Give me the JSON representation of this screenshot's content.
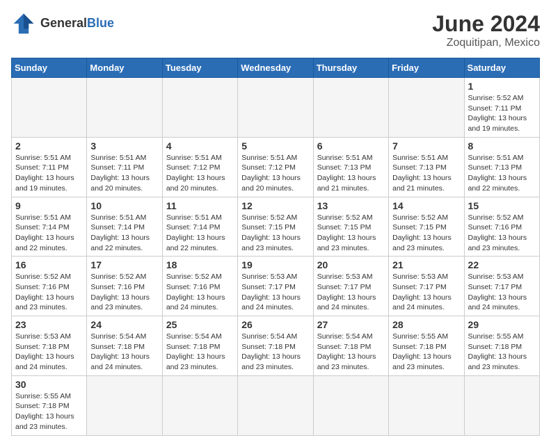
{
  "header": {
    "logo_general": "General",
    "logo_blue": "Blue",
    "month_title": "June 2024",
    "location": "Zoquitipan, Mexico"
  },
  "days_of_week": [
    "Sunday",
    "Monday",
    "Tuesday",
    "Wednesday",
    "Thursday",
    "Friday",
    "Saturday"
  ],
  "weeks": [
    [
      {
        "day": "",
        "empty": true
      },
      {
        "day": "",
        "empty": true
      },
      {
        "day": "",
        "empty": true
      },
      {
        "day": "",
        "empty": true
      },
      {
        "day": "",
        "empty": true
      },
      {
        "day": "",
        "empty": true
      },
      {
        "day": "1",
        "sunrise": "5:52 AM",
        "sunset": "7:11 PM",
        "daylight": "13 hours and 19 minutes."
      }
    ],
    [
      {
        "day": "2",
        "sunrise": "5:51 AM",
        "sunset": "7:11 PM",
        "daylight": "13 hours and 19 minutes."
      },
      {
        "day": "3",
        "sunrise": "5:51 AM",
        "sunset": "7:11 PM",
        "daylight": "13 hours and 20 minutes."
      },
      {
        "day": "4",
        "sunrise": "5:51 AM",
        "sunset": "7:12 PM",
        "daylight": "13 hours and 20 minutes."
      },
      {
        "day": "5",
        "sunrise": "5:51 AM",
        "sunset": "7:12 PM",
        "daylight": "13 hours and 20 minutes."
      },
      {
        "day": "6",
        "sunrise": "5:51 AM",
        "sunset": "7:13 PM",
        "daylight": "13 hours and 21 minutes."
      },
      {
        "day": "7",
        "sunrise": "5:51 AM",
        "sunset": "7:13 PM",
        "daylight": "13 hours and 21 minutes."
      },
      {
        "day": "8",
        "sunrise": "5:51 AM",
        "sunset": "7:13 PM",
        "daylight": "13 hours and 22 minutes."
      }
    ],
    [
      {
        "day": "9",
        "sunrise": "5:51 AM",
        "sunset": "7:14 PM",
        "daylight": "13 hours and 22 minutes."
      },
      {
        "day": "10",
        "sunrise": "5:51 AM",
        "sunset": "7:14 PM",
        "daylight": "13 hours and 22 minutes."
      },
      {
        "day": "11",
        "sunrise": "5:51 AM",
        "sunset": "7:14 PM",
        "daylight": "13 hours and 22 minutes."
      },
      {
        "day": "12",
        "sunrise": "5:52 AM",
        "sunset": "7:15 PM",
        "daylight": "13 hours and 23 minutes."
      },
      {
        "day": "13",
        "sunrise": "5:52 AM",
        "sunset": "7:15 PM",
        "daylight": "13 hours and 23 minutes."
      },
      {
        "day": "14",
        "sunrise": "5:52 AM",
        "sunset": "7:15 PM",
        "daylight": "13 hours and 23 minutes."
      },
      {
        "day": "15",
        "sunrise": "5:52 AM",
        "sunset": "7:16 PM",
        "daylight": "13 hours and 23 minutes."
      }
    ],
    [
      {
        "day": "16",
        "sunrise": "5:52 AM",
        "sunset": "7:16 PM",
        "daylight": "13 hours and 23 minutes."
      },
      {
        "day": "17",
        "sunrise": "5:52 AM",
        "sunset": "7:16 PM",
        "daylight": "13 hours and 23 minutes."
      },
      {
        "day": "18",
        "sunrise": "5:52 AM",
        "sunset": "7:16 PM",
        "daylight": "13 hours and 24 minutes."
      },
      {
        "day": "19",
        "sunrise": "5:53 AM",
        "sunset": "7:17 PM",
        "daylight": "13 hours and 24 minutes."
      },
      {
        "day": "20",
        "sunrise": "5:53 AM",
        "sunset": "7:17 PM",
        "daylight": "13 hours and 24 minutes."
      },
      {
        "day": "21",
        "sunrise": "5:53 AM",
        "sunset": "7:17 PM",
        "daylight": "13 hours and 24 minutes."
      },
      {
        "day": "22",
        "sunrise": "5:53 AM",
        "sunset": "7:17 PM",
        "daylight": "13 hours and 24 minutes."
      }
    ],
    [
      {
        "day": "23",
        "sunrise": "5:53 AM",
        "sunset": "7:18 PM",
        "daylight": "13 hours and 24 minutes."
      },
      {
        "day": "24",
        "sunrise": "5:54 AM",
        "sunset": "7:18 PM",
        "daylight": "13 hours and 24 minutes."
      },
      {
        "day": "25",
        "sunrise": "5:54 AM",
        "sunset": "7:18 PM",
        "daylight": "13 hours and 23 minutes."
      },
      {
        "day": "26",
        "sunrise": "5:54 AM",
        "sunset": "7:18 PM",
        "daylight": "13 hours and 23 minutes."
      },
      {
        "day": "27",
        "sunrise": "5:54 AM",
        "sunset": "7:18 PM",
        "daylight": "13 hours and 23 minutes."
      },
      {
        "day": "28",
        "sunrise": "5:55 AM",
        "sunset": "7:18 PM",
        "daylight": "13 hours and 23 minutes."
      },
      {
        "day": "29",
        "sunrise": "5:55 AM",
        "sunset": "7:18 PM",
        "daylight": "13 hours and 23 minutes."
      }
    ],
    [
      {
        "day": "30",
        "sunrise": "5:55 AM",
        "sunset": "7:18 PM",
        "daylight": "13 hours and 23 minutes."
      },
      {
        "day": "",
        "empty": true
      },
      {
        "day": "",
        "empty": true
      },
      {
        "day": "",
        "empty": true
      },
      {
        "day": "",
        "empty": true
      },
      {
        "day": "",
        "empty": true
      },
      {
        "day": "",
        "empty": true
      }
    ]
  ],
  "labels": {
    "sunrise": "Sunrise:",
    "sunset": "Sunset:",
    "daylight": "Daylight:"
  },
  "colors": {
    "header_bg": "#2a6db5",
    "logo_blue": "#2a6db5"
  }
}
